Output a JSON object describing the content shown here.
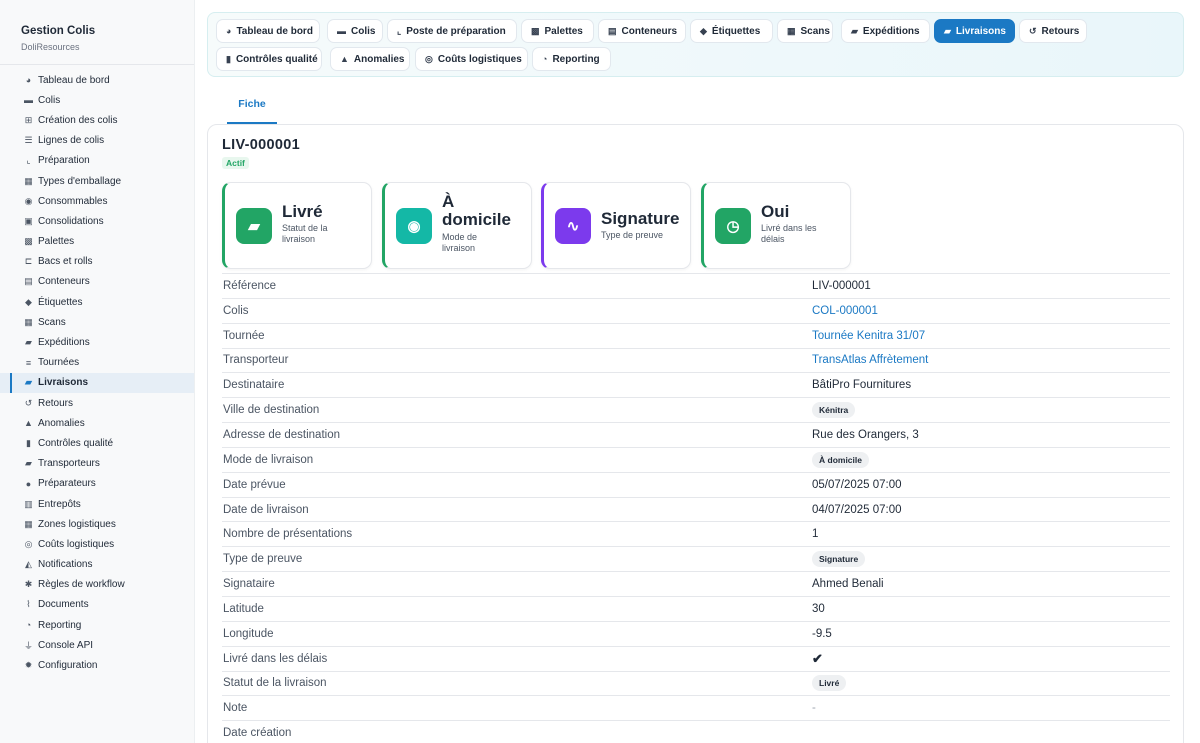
{
  "brand": {
    "title": "Gestion Colis",
    "subtitle": "DoliResources"
  },
  "sidebar": [
    {
      "label": "Tableau de bord",
      "icon": "dashboard-icon",
      "glyph": "◕"
    },
    {
      "label": "Colis",
      "icon": "box-icon",
      "glyph": "▬"
    },
    {
      "label": "Création des colis",
      "icon": "plus-square-icon",
      "glyph": "⊞"
    },
    {
      "label": "Lignes de colis",
      "icon": "list-icon",
      "glyph": "☰"
    },
    {
      "label": "Préparation",
      "icon": "dolly-icon",
      "glyph": "⌞"
    },
    {
      "label": "Types d'emballage",
      "icon": "boxes-icon",
      "glyph": "▦"
    },
    {
      "label": "Consommables",
      "icon": "tape-icon",
      "glyph": "◉"
    },
    {
      "label": "Consolidations",
      "icon": "archive-icon",
      "glyph": "▣"
    },
    {
      "label": "Palettes",
      "icon": "pallet-icon",
      "glyph": "▩"
    },
    {
      "label": "Bacs et rolls",
      "icon": "dolly-flatbed-icon",
      "glyph": "⊏"
    },
    {
      "label": "Conteneurs",
      "icon": "container-icon",
      "glyph": "▤"
    },
    {
      "label": "Étiquettes",
      "icon": "tags-icon",
      "glyph": "◆"
    },
    {
      "label": "Scans",
      "icon": "qrcode-icon",
      "glyph": "▦"
    },
    {
      "label": "Expéditions",
      "icon": "truck-icon",
      "glyph": "▰"
    },
    {
      "label": "Tournées",
      "icon": "route-icon",
      "glyph": "≡"
    },
    {
      "label": "Livraisons",
      "icon": "truck-loading-icon",
      "glyph": "▰",
      "active": true
    },
    {
      "label": "Retours",
      "icon": "undo-icon",
      "glyph": "↺"
    },
    {
      "label": "Anomalies",
      "icon": "warning-icon",
      "glyph": "▲"
    },
    {
      "label": "Contrôles qualité",
      "icon": "clipboard-check-icon",
      "glyph": "▮"
    },
    {
      "label": "Transporteurs",
      "icon": "shipping-fast-icon",
      "glyph": "▰"
    },
    {
      "label": "Préparateurs",
      "icon": "user-cog-icon",
      "glyph": "●"
    },
    {
      "label": "Entrepôts",
      "icon": "warehouse-icon",
      "glyph": "▥"
    },
    {
      "label": "Zones logistiques",
      "icon": "grid-icon",
      "glyph": "▦"
    },
    {
      "label": "Coûts logistiques",
      "icon": "coins-icon",
      "glyph": "◎"
    },
    {
      "label": "Notifications",
      "icon": "bell-icon",
      "glyph": "◭"
    },
    {
      "label": "Règles de workflow",
      "icon": "cogs-icon",
      "glyph": "✱"
    },
    {
      "label": "Documents",
      "icon": "paperclip-icon",
      "glyph": "⌇"
    },
    {
      "label": "Reporting",
      "icon": "chart-pie-icon",
      "glyph": "◔"
    },
    {
      "label": "Console API",
      "icon": "plug-icon",
      "glyph": "⏚"
    },
    {
      "label": "Configuration",
      "icon": "gear-icon",
      "glyph": "✹"
    }
  ],
  "tabs": [
    {
      "label": "Tableau de bord",
      "icon": "dashboard-icon",
      "glyph": "◕"
    },
    {
      "label": "Colis",
      "icon": "box-icon",
      "glyph": "▬"
    },
    {
      "label": "Poste de préparation",
      "icon": "dolly-icon",
      "glyph": "⌞"
    },
    {
      "label": "Palettes",
      "icon": "pallet-icon",
      "glyph": "▩"
    },
    {
      "label": "Conteneurs",
      "icon": "container-icon",
      "glyph": "▤"
    },
    {
      "label": "Étiquettes",
      "icon": "tags-icon",
      "glyph": "◆"
    },
    {
      "label": "Scans",
      "icon": "qrcode-icon",
      "glyph": "▦"
    },
    {
      "label": "Expéditions",
      "icon": "truck-icon",
      "glyph": "▰"
    },
    {
      "label": "Livraisons",
      "icon": "truck-loading-icon",
      "glyph": "▰",
      "active": true
    },
    {
      "label": "Retours",
      "icon": "undo-icon",
      "glyph": "↺"
    },
    {
      "label": "Contrôles qualité",
      "icon": "clipboard-check-icon",
      "glyph": "▮"
    },
    {
      "label": "Anomalies",
      "icon": "warning-icon",
      "glyph": "▲"
    },
    {
      "label": "Coûts logistiques",
      "icon": "coins-icon",
      "glyph": "◎"
    },
    {
      "label": "Reporting",
      "icon": "chart-pie-icon",
      "glyph": "◔"
    }
  ],
  "subtab": {
    "label": "Fiche"
  },
  "record": {
    "ref": "LIV-000001",
    "status": "Actif"
  },
  "kpis": [
    {
      "value": "Livré",
      "label": "Statut de la livraison",
      "icon": "truck-loading-icon",
      "glyph": "▰",
      "color": "#22a565",
      "accent": "#22a565"
    },
    {
      "value": "À domicile",
      "label": "Mode de livraison",
      "icon": "map-marker-icon",
      "glyph": "◉",
      "color": "#14b8a6",
      "accent": "#22a565"
    },
    {
      "value": "Signature",
      "label": "Type de preuve",
      "icon": "signature-icon",
      "glyph": "∿",
      "color": "#7c3aed",
      "accent": "#7c3aed"
    },
    {
      "value": "Oui",
      "label": "Livré dans les délais",
      "icon": "stopwatch-icon",
      "glyph": "◷",
      "color": "#22a565",
      "accent": "#22a565"
    }
  ],
  "fields": [
    {
      "label": "Référence",
      "value": "LIV-000001",
      "type": "text"
    },
    {
      "label": "Colis",
      "value": "COL-000001",
      "type": "link"
    },
    {
      "label": "Tournée",
      "value": "Tournée Kenitra 31/07",
      "type": "link"
    },
    {
      "label": "Transporteur",
      "value": "TransAtlas Affrètement",
      "type": "link"
    },
    {
      "label": "Destinataire",
      "value": "BâtiPro Fournitures",
      "type": "text"
    },
    {
      "label": "Ville de destination",
      "value": "Kénitra",
      "type": "pill"
    },
    {
      "label": "Adresse de destination",
      "value": "Rue des Orangers, 3",
      "type": "text"
    },
    {
      "label": "Mode de livraison",
      "value": "À domicile",
      "type": "pill"
    },
    {
      "label": "Date prévue",
      "value": "05/07/2025 07:00",
      "type": "text"
    },
    {
      "label": "Date de livraison",
      "value": "04/07/2025 07:00",
      "type": "text"
    },
    {
      "label": "Nombre de présentations",
      "value": "1",
      "type": "text"
    },
    {
      "label": "Type de preuve",
      "value": "Signature",
      "type": "pill"
    },
    {
      "label": "Signataire",
      "value": "Ahmed Benali",
      "type": "text"
    },
    {
      "label": "Latitude",
      "value": "30",
      "type": "text"
    },
    {
      "label": "Longitude",
      "value": "-9.5",
      "type": "text"
    },
    {
      "label": "Livré dans les délais",
      "value": "✔",
      "type": "check"
    },
    {
      "label": "Statut de la livraison",
      "value": "Livré",
      "type": "pill"
    },
    {
      "label": "Note",
      "value": "-",
      "type": "muted"
    },
    {
      "label": "Date création",
      "value": "",
      "type": "text"
    }
  ]
}
